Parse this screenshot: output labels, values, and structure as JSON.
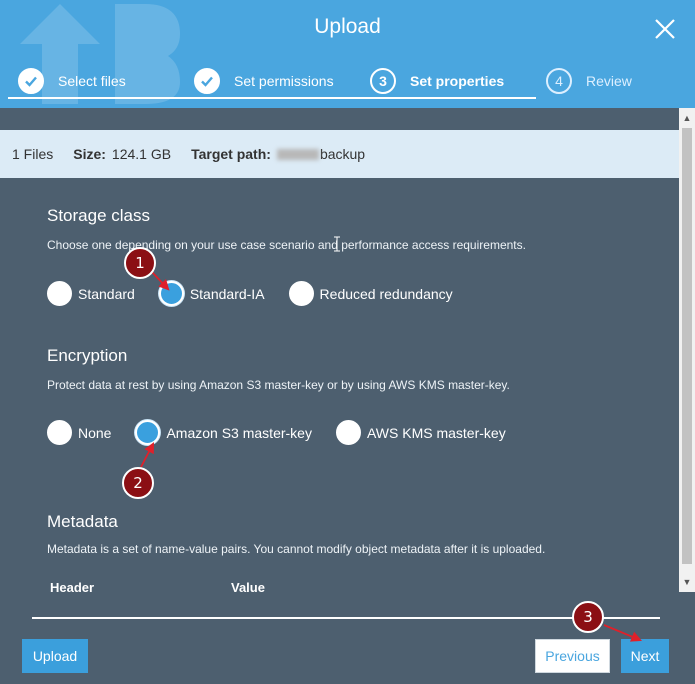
{
  "dialog": {
    "title": "Upload"
  },
  "steps": [
    {
      "label": "Select files",
      "number": "1",
      "state": "done"
    },
    {
      "label": "Set permissions",
      "number": "2",
      "state": "done"
    },
    {
      "label": "Set properties",
      "number": "3",
      "state": "active"
    },
    {
      "label": "Review",
      "number": "4",
      "state": "pending"
    }
  ],
  "info": {
    "files": "1 Files",
    "size_label": "Size:",
    "size_value": "124.1 GB",
    "path_label": "Target path:",
    "path_value": "backup"
  },
  "storage": {
    "title": "Storage class",
    "description": "Choose one depending on your use case scenario and performance access requirements.",
    "options": [
      "Standard",
      "Standard-IA",
      "Reduced redundancy"
    ],
    "selected": "Standard-IA"
  },
  "encryption": {
    "title": "Encryption",
    "description": "Protect data at rest by using Amazon S3 master-key or by using AWS KMS master-key.",
    "options": [
      "None",
      "Amazon S3 master-key",
      "AWS KMS master-key"
    ],
    "selected": "Amazon S3 master-key"
  },
  "metadata": {
    "title": "Metadata",
    "description": "Metadata is a set of name-value pairs. You cannot modify object metadata after it is uploaded.",
    "columns": [
      "Header",
      "Value"
    ]
  },
  "footer": {
    "upload": "Upload",
    "previous": "Previous",
    "next": "Next"
  },
  "annotations": [
    "1",
    "2",
    "3"
  ],
  "colors": {
    "header": "#4aa6df",
    "body": "#4d5f6f",
    "annotation": "#8b0f14",
    "selected_radio": "#3aa0de"
  }
}
